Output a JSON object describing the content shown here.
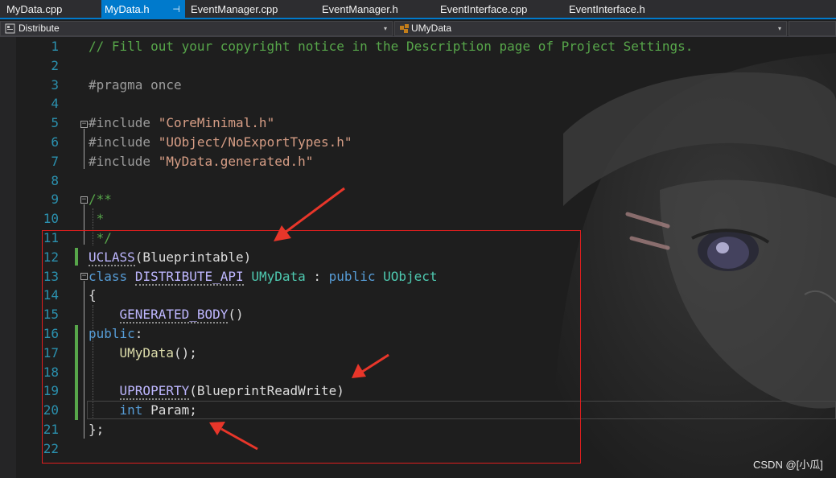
{
  "tabs": [
    {
      "label": "MyData.cpp",
      "active": false
    },
    {
      "label": "MyData.h",
      "active": true,
      "pin": "⊣"
    },
    {
      "label": "EventManager.cpp",
      "active": false
    },
    {
      "label": "EventManager.h",
      "active": false
    },
    {
      "label": "EventInterface.cpp",
      "active": false
    },
    {
      "label": "EventInterface.h",
      "active": false
    }
  ],
  "nav": {
    "project": "Distribute",
    "scope": "UMyData",
    "dropdown_glyph": "▾"
  },
  "code_lines": [
    {
      "number": "1"
    },
    {
      "number": "2"
    },
    {
      "number": "3"
    },
    {
      "number": "4"
    },
    {
      "number": "5"
    },
    {
      "number": "6"
    },
    {
      "number": "7"
    },
    {
      "number": "8"
    },
    {
      "number": "9"
    },
    {
      "number": "10"
    },
    {
      "number": "11"
    },
    {
      "number": "12"
    },
    {
      "number": "13"
    },
    {
      "number": "14"
    },
    {
      "number": "15"
    },
    {
      "number": "16"
    },
    {
      "number": "17"
    },
    {
      "number": "18"
    },
    {
      "number": "19"
    },
    {
      "number": "20"
    },
    {
      "number": "21"
    },
    {
      "number": "22"
    }
  ],
  "code": {
    "l1": "// Fill out your copyright notice in the Description page of Project Settings.",
    "l3": "#pragma once",
    "l5_pp": "#include",
    "l5_str": "\"CoreMinimal.h\"",
    "l6_pp": "#include",
    "l6_str": "\"UObject/NoExportTypes.h\"",
    "l7_pp": "#include",
    "l7_str": "\"MyData.generated.h\"",
    "l9": "/**",
    "l10": " *",
    "l11": " */",
    "l12_macro": "UCLASS",
    "l12_rest": "(Blueprintable)",
    "l13_kw": "class",
    "l13_api": "DISTRIBUTE_API",
    "l13_name": "UMyData",
    "l13_colon": " : ",
    "l13_public": "public",
    "l13_base": "UObject",
    "l14": "{",
    "l15_macro": "GENERATED_BODY",
    "l15_rest": "()",
    "l16_kw": "public",
    "l16_rest": ":",
    "l17_fn": "UMyData",
    "l17_rest": "();",
    "l19_macro": "UPROPERTY",
    "l19_rest": "(BlueprintReadWrite)",
    "l20_kw": "int",
    "l20_rest": " Param;",
    "l21": "};",
    "fold_glyph": "−"
  },
  "colors": {
    "accent": "#007acc",
    "highlight_box": "#e01e1e",
    "arrow": "#e8362a",
    "line_number": "#2b91af",
    "comment": "#57a64a",
    "keyword": "#569cd6",
    "string": "#d69d85",
    "macro": "#beb7ff",
    "type": "#4ec9b0"
  },
  "watermark": "CSDN @[小瓜]"
}
